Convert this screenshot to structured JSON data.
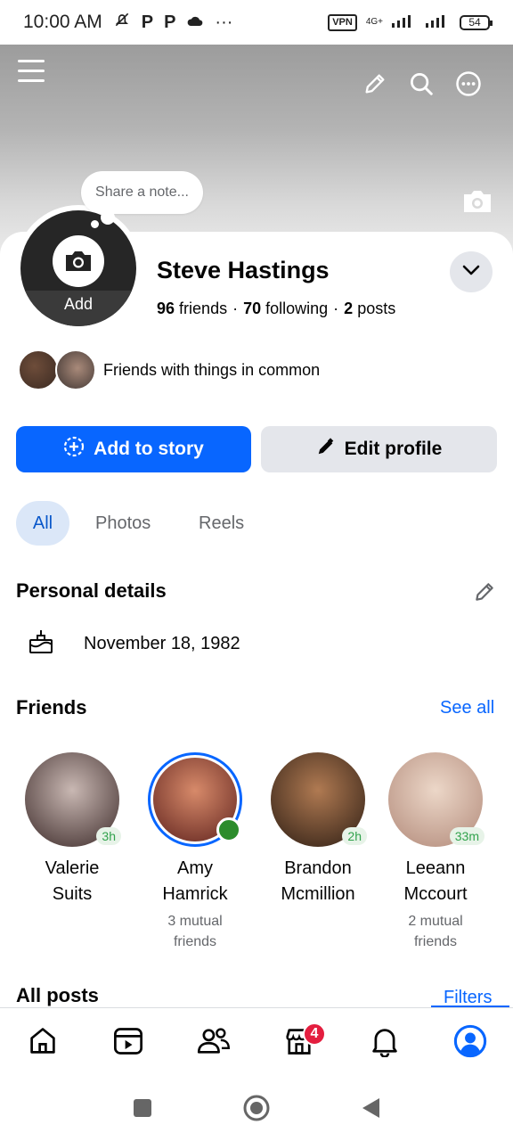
{
  "status_bar": {
    "time": "10:00 AM",
    "glyphs": [
      "P",
      "P"
    ],
    "more": "···",
    "vpn": "VPN",
    "network": "4G+",
    "battery": "54"
  },
  "profile": {
    "note_placeholder": "Share a note...",
    "avatar_add_label": "Add",
    "name": "Steve Hastings",
    "friends_count": "96",
    "friends_label": "friends",
    "following_count": "70",
    "following_label": "following",
    "posts_count": "2",
    "posts_label": "posts",
    "common_text": "Friends with things in common"
  },
  "actions": {
    "add_story": "Add to story",
    "edit_profile": "Edit profile"
  },
  "tabs": [
    {
      "label": "All",
      "active": true
    },
    {
      "label": "Photos",
      "active": false
    },
    {
      "label": "Reels",
      "active": false
    }
  ],
  "personal_details": {
    "title": "Personal details",
    "birthday": "November 18, 1982"
  },
  "friends": {
    "title": "Friends",
    "see_all": "See all",
    "items": [
      {
        "name_line1": "Valerie",
        "name_line2": "Suits",
        "badge": "3h",
        "mutual_line1": "",
        "mutual_line2": "",
        "story_ring": false,
        "online": false,
        "colors": [
          "#c9b8b3",
          "#3d2b2a"
        ]
      },
      {
        "name_line1": "Amy",
        "name_line2": "Hamrick",
        "badge": "",
        "mutual_line1": "3 mutual",
        "mutual_line2": "friends",
        "story_ring": true,
        "online": true,
        "colors": [
          "#d78a6a",
          "#5a1e1a"
        ]
      },
      {
        "name_line1": "Brandon",
        "name_line2": "Mcmillion",
        "badge": "2h",
        "mutual_line1": "",
        "mutual_line2": "",
        "story_ring": false,
        "online": false,
        "colors": [
          "#b07a52",
          "#2e1e14"
        ]
      },
      {
        "name_line1": "Leeann",
        "name_line2": "Mccourt",
        "badge": "33m",
        "mutual_line1": "2 mutual",
        "mutual_line2": "friends",
        "story_ring": false,
        "online": false,
        "colors": [
          "#ecd7c8",
          "#b28a7a"
        ]
      }
    ]
  },
  "posts": {
    "title": "All posts",
    "filters": "Filters"
  },
  "bottom_nav": {
    "items": [
      "home-icon",
      "video-icon",
      "friends-icon",
      "marketplace-icon",
      "notifications-icon",
      "profile-icon"
    ],
    "marketplace_badge": "4",
    "active": "profile-icon"
  },
  "colors": {
    "accent": "#0866ff",
    "secondary_button": "#e4e6eb",
    "active_tab_bg": "#dbe7f8",
    "online": "#2b8c2b",
    "badge": "#e41e3f"
  }
}
